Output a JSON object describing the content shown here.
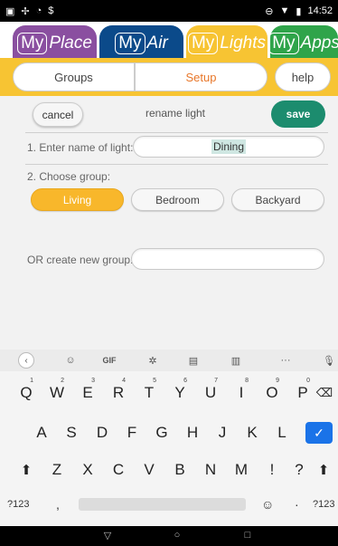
{
  "status": {
    "left_icons": [
      "image-icon",
      "fan-icon",
      "clock-icon",
      "dollar-icon"
    ],
    "right_icons": [
      "circle-minus-icon",
      "wifi-icon",
      "battery-icon"
    ],
    "time": "14:52"
  },
  "apps": {
    "place": {
      "m": "My",
      "rest": "Place"
    },
    "air": {
      "m": "My",
      "rest": "Air"
    },
    "lights": {
      "m": "My",
      "rest": "Lights"
    },
    "apps": {
      "m": "My",
      "rest": "Apps"
    }
  },
  "segments": {
    "groups": "Groups",
    "setup": "Setup",
    "help": "help"
  },
  "form": {
    "cancel": "cancel",
    "title": "rename light",
    "save": "save",
    "name_label": "1. Enter name of light:",
    "name_value": "Dining",
    "group_label": "2. Choose group:",
    "groups": [
      "Living",
      "Bedroom",
      "Backyard"
    ],
    "selected_group": "Living",
    "new_group_label": "OR create new group:",
    "new_group_value": ""
  },
  "keyboard": {
    "toolbar": {
      "gif": "GIF",
      "more": "···"
    },
    "row1": [
      "Q",
      "W",
      "E",
      "R",
      "T",
      "Y",
      "U",
      "I",
      "O",
      "P"
    ],
    "row1_nums": [
      "1",
      "2",
      "3",
      "4",
      "5",
      "6",
      "7",
      "8",
      "9",
      "0"
    ],
    "row2": [
      "A",
      "S",
      "D",
      "F",
      "G",
      "H",
      "J",
      "K",
      "L"
    ],
    "row3": [
      "Z",
      "X",
      "C",
      "V",
      "B",
      "N",
      "M",
      "!",
      "?"
    ],
    "bottom": {
      "sym_left": "?123",
      "comma": ",",
      "period": "·",
      "sym_right": "?123"
    }
  },
  "colors": {
    "accent": "#f7c433",
    "save": "#1c8c6e",
    "place": "#8a4fa0",
    "air": "#0b4a8a",
    "apps": "#2fa44a",
    "enter": "#1a73e8"
  }
}
